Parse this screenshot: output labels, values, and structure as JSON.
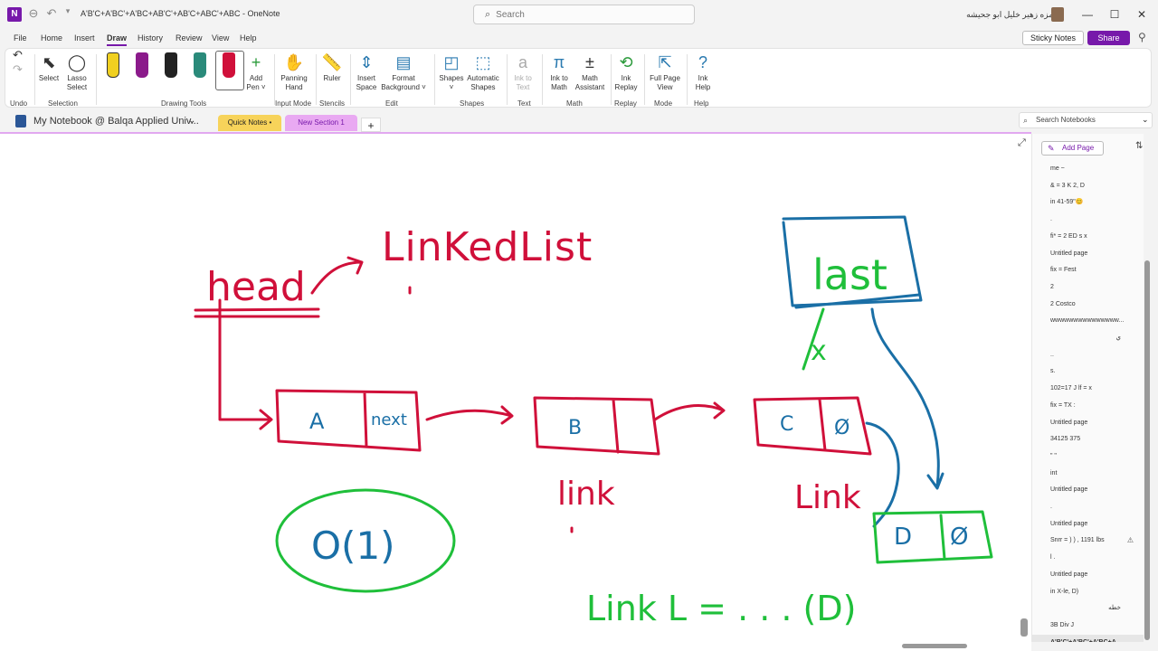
{
  "app": {
    "logo_text": "N",
    "window_title": "A'B'C+A'BC'+A'BC+AB'C'+AB'C+ABC'+ABC  -  OneNote",
    "user_name": "حمزه زهير خليل ابو جحيشه"
  },
  "search": {
    "placeholder": "Search"
  },
  "window_controls": {
    "minimize": "—",
    "maximize": "☐",
    "close": "✕"
  },
  "menu": {
    "tabs": [
      "File",
      "Home",
      "Insert",
      "Draw",
      "History",
      "Review",
      "View",
      "Help"
    ],
    "active": "Draw",
    "sticky_notes": "Sticky Notes",
    "share": "Share"
  },
  "ribbon": {
    "undo_group": "Undo",
    "select": "Select",
    "lasso": [
      "Lasso",
      "Select"
    ],
    "selection_group": "Selection",
    "add_pen": [
      "Add",
      "Pen ˅"
    ],
    "drawing_tools_group": "Drawing Tools",
    "panning": [
      "Panning",
      "Hand"
    ],
    "input_mode_group": "Input Mode",
    "ruler": "Ruler",
    "stencils_group": "Stencils",
    "insert_space": [
      "Insert",
      "Space"
    ],
    "format_background": [
      "Format",
      "Background ˅"
    ],
    "edit_group": "Edit",
    "shapes": [
      "Shapes",
      "˅"
    ],
    "auto_shapes": [
      "Automatic",
      "Shapes"
    ],
    "shapes_group": "Shapes",
    "ink_to_text": [
      "Ink to",
      "Text"
    ],
    "text_group": "Text",
    "ink_to_math": [
      "Ink to",
      "Math"
    ],
    "math_assistant": [
      "Math",
      "Assistant"
    ],
    "math_group": "Math",
    "ink_replay": [
      "Ink",
      "Replay"
    ],
    "replay_group": "Replay",
    "full_page": [
      "Full Page",
      "View"
    ],
    "mode_group": "Mode",
    "ink_help": [
      "Ink",
      "Help"
    ],
    "help_group": "Help",
    "pen_colors": [
      "#f0d020",
      "#8b1a8b",
      "#222222",
      "#2a8a7a",
      "#d0103a"
    ]
  },
  "notebook": {
    "name": "My Notebook @ Balqa Applied Univ...",
    "sections": [
      "Quick Notes",
      "New Section 1"
    ],
    "section_colors": [
      "#f7d35a",
      "#e9a9f2"
    ],
    "add_section": "+",
    "search_notebooks": "Search Notebooks"
  },
  "pages": {
    "add_page": "Add Page",
    "items": [
      "me ~",
      "& = 3 K 2, D",
      "in 41-59\"😊",
      ".",
      "fi* = 2 ED s x",
      "Untitled page",
      "fix = Fest",
      "2",
      "2 Costco",
      "wwwwwwwwwwwwwww...",
      "ي",
      "..",
      "s.",
      "102=17 J lf = x",
      "fix = TX :",
      "Untitled page",
      "34125 375",
      "\" \"",
      "int",
      "Untitled page",
      ".",
      "Untitled page",
      "Snrr = ) ) , 1191 lbs",
      "l .",
      "Untitled page",
      "in X-le, D)",
      "خطه",
      "3B Div J",
      "A'B'C'+A'BC'+A'BC+A..."
    ],
    "rtl_items": [
      10,
      26
    ],
    "selected_index": 28,
    "warn_index": 22
  },
  "ink": {
    "colors": {
      "red": "#d0103a",
      "blue": "#1a6fa6",
      "green": "#1fbf3a"
    },
    "texts": {
      "linked_list": "LinKedList",
      "head": "head",
      "node_a": "A",
      "next": "next",
      "node_b": "B",
      "node_c": "C",
      "null_c": "Ø",
      "link_label_1": "link",
      "link_label_2": "Link",
      "last": "last",
      "x_mark": "x",
      "node_d": "D",
      "null_d": "Ø",
      "circle_text": "O(1)",
      "link_bottom": "Link L = . . . (D)"
    }
  }
}
